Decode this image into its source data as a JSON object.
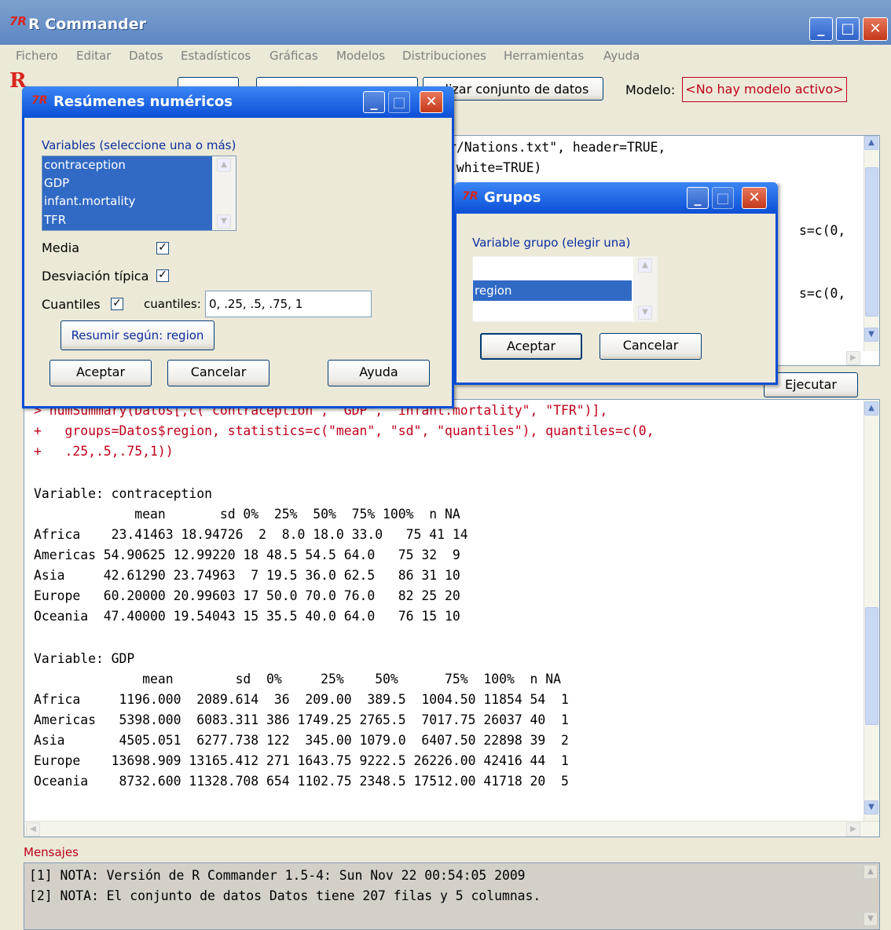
{
  "window": {
    "title": "R Commander",
    "icon": "r-logo-icon",
    "controls": [
      "_",
      "□",
      "X"
    ]
  },
  "menu": [
    "Fichero",
    "Editar",
    "Datos",
    "Estadísticos",
    "Gráficas",
    "Modelos",
    "Distribuciones",
    "Herramientas",
    "Ayuda"
  ],
  "toolbar": {
    "edit_dataset_label": "alizar conjunto de datos",
    "model_label": "Modelo:",
    "model_value": "<No hay modelo activo>"
  },
  "script_lines": [
    "r/Nations.txt\", header=TRUE,",
    ".white=TRUE)",
    "s=c(0,",
    "s=c(0,"
  ],
  "run_button": "Ejecutar",
  "output": {
    "command": [
      "> numSummary(Datos[,c(\"contraception\", \"GDP\", \"infant.mortality\", \"TFR\")],",
      "+   groups=Datos$region, statistics=c(\"mean\", \"sd\", \"quantiles\"), quantiles=c(0,",
      "+   .25,.5,.75,1))"
    ],
    "block1": [
      "Variable: contraception",
      "             mean       sd 0%  25%  50%  75% 100%  n NA",
      "Africa    23.41463 18.94726  2  8.0 18.0 33.0   75 41 14",
      "Americas 54.90625 12.99220 18 48.5 54.5 64.0   75 32  9",
      "Asia     42.61290 23.74963  7 19.5 36.0 62.5   86 31 10",
      "Europe   60.20000 20.99603 17 50.0 70.0 76.0   82 25 20",
      "Oceania  47.40000 19.54043 15 35.5 40.0 64.0   76 15 10"
    ],
    "block2": [
      "Variable: GDP",
      "              mean        sd  0%     25%    50%      75%  100%  n NA",
      "Africa     1196.000  2089.614  36  209.00  389.5  1004.50 11854 54  1",
      "Americas   5398.000  6083.311 386 1749.25 2765.5  7017.75 26037 40  1",
      "Asia       4505.051  6277.738 122  345.00 1079.0  6407.50 22898 39  2",
      "Europe    13698.909 13165.412 271 1643.75 9222.5 26226.00 42416 44  1",
      "Oceania    8732.600 11328.708 654 1102.75 2348.5 17512.00 41718 20  5"
    ]
  },
  "messages": {
    "label": "Mensajes",
    "lines": [
      "[1] NOTA: Versión de R Commander 1.5-4: Sun Nov 22 00:54:05 2009",
      "[2] NOTA: El conjunto de datos Datos tiene 207 filas y 5 columnas."
    ]
  },
  "dialog_summary": {
    "title": "Resúmenes numéricos",
    "variables_label": "Variables (seleccione una o más)",
    "variables": [
      "contraception",
      "GDP",
      "infant.mortality",
      "TFR"
    ],
    "mean_label": "Media",
    "mean_checked": true,
    "sd_label": "Desviación típica",
    "sd_checked": true,
    "quantiles_label": "Cuantiles",
    "quantiles_checked": true,
    "quantiles_field_label": "cuantiles:",
    "quantiles_value": "0, .25, .5, .75, 1",
    "group_button": "Resumir según: region",
    "ok": "Aceptar",
    "cancel": "Cancelar",
    "help": "Ayuda"
  },
  "dialog_groups": {
    "title": "Grupos",
    "label": "Variable grupo (elegir una)",
    "options": [
      "region"
    ],
    "ok": "Aceptar",
    "cancel": "Cancelar"
  }
}
